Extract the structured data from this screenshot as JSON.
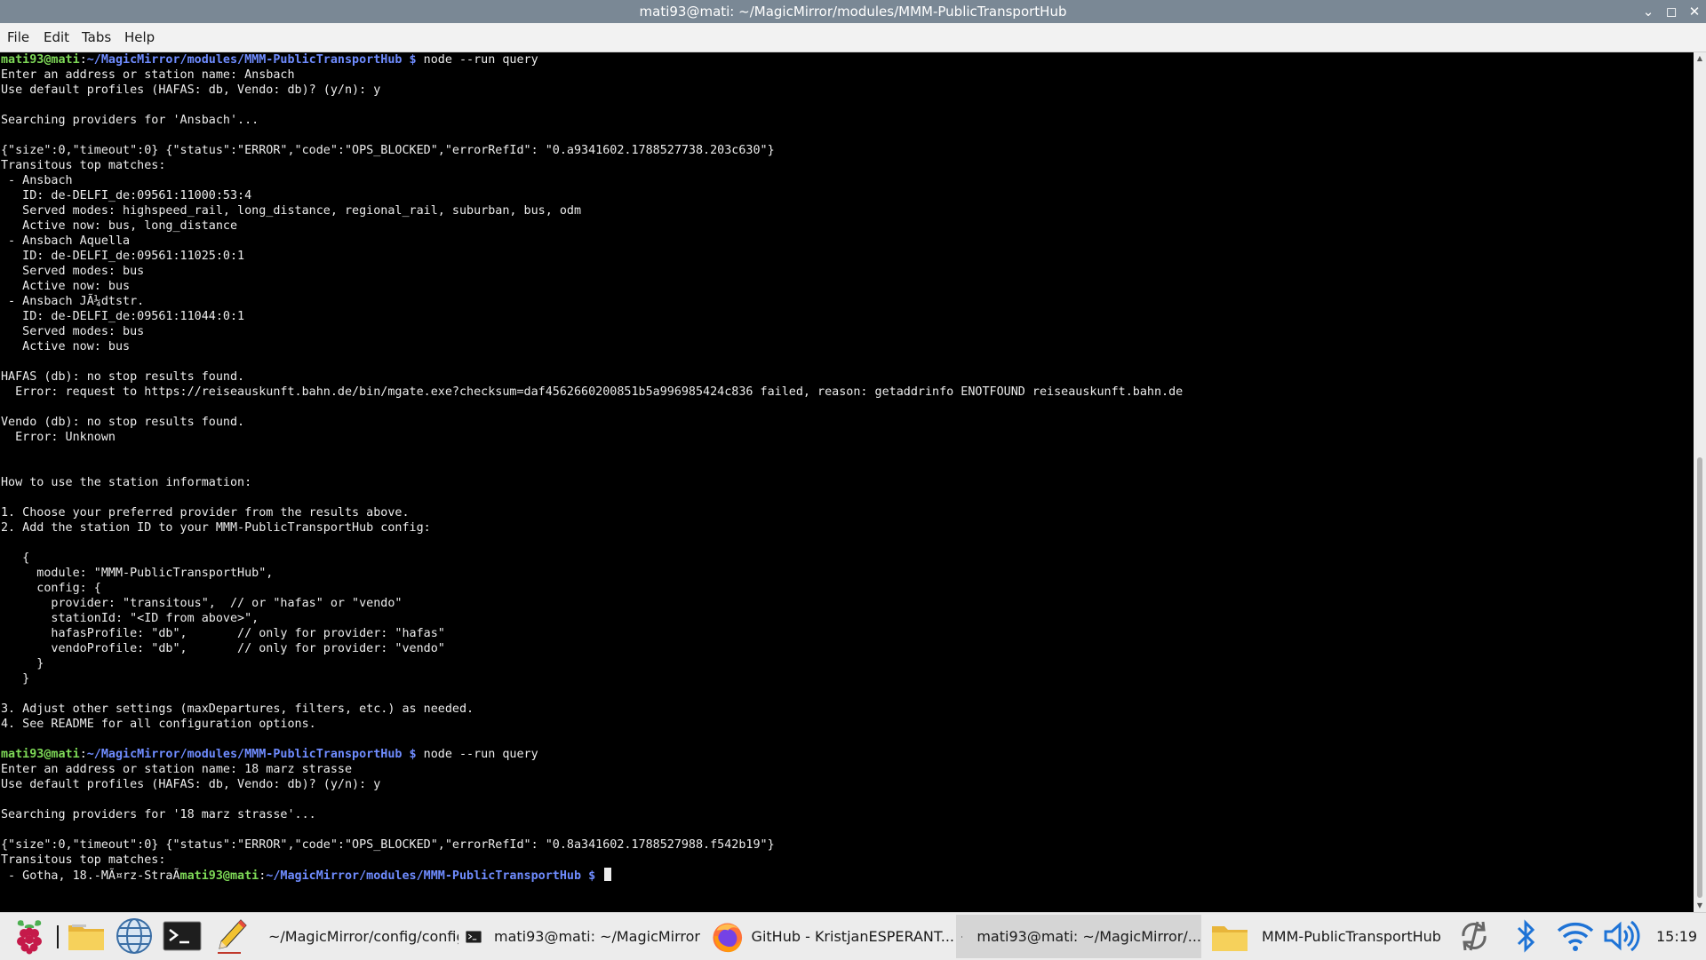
{
  "window": {
    "title": "mati93@mati: ~/MagicMirror/modules/MMM-PublicTransportHub"
  },
  "menu": [
    "File",
    "Edit",
    "Tabs",
    "Help"
  ],
  "terminal": {
    "prompt": {
      "user": "mati93@mati",
      "path": "~/MagicMirror/modules/MMM-PublicTransportHub",
      "symbol": "$"
    },
    "lines": [
      {
        "t": "prompt",
        "cmd": " node --run query"
      },
      {
        "t": "text",
        "text": "Enter an address or station name: Ansbach"
      },
      {
        "t": "text",
        "text": "Use default profiles (HAFAS: db, Vendo: db)? (y/n): y"
      },
      {
        "t": "blank"
      },
      {
        "t": "text",
        "text": "Searching providers for 'Ansbach'..."
      },
      {
        "t": "blank"
      },
      {
        "t": "text",
        "text": "{\"size\":0,\"timeout\":0} {\"status\":\"ERROR\",\"code\":\"OPS_BLOCKED\",\"errorRefId\": \"0.a9341602.1788527738.203c630\"}"
      },
      {
        "t": "text",
        "text": "Transitous top matches:"
      },
      {
        "t": "text",
        "text": " - Ansbach"
      },
      {
        "t": "text",
        "text": "   ID: de-DELFI_de:09561:11000:53:4"
      },
      {
        "t": "text",
        "text": "   Served modes: highspeed_rail, long_distance, regional_rail, suburban, bus, odm"
      },
      {
        "t": "text",
        "text": "   Active now: bus, long_distance"
      },
      {
        "t": "text",
        "text": " - Ansbach Aquella"
      },
      {
        "t": "text",
        "text": "   ID: de-DELFI_de:09561:11025:0:1"
      },
      {
        "t": "text",
        "text": "   Served modes: bus"
      },
      {
        "t": "text",
        "text": "   Active now: bus"
      },
      {
        "t": "text",
        "text": " - Ansbach JÃ¼dtstr."
      },
      {
        "t": "text",
        "text": "   ID: de-DELFI_de:09561:11044:0:1"
      },
      {
        "t": "text",
        "text": "   Served modes: bus"
      },
      {
        "t": "text",
        "text": "   Active now: bus"
      },
      {
        "t": "blank"
      },
      {
        "t": "text",
        "text": "HAFAS (db): no stop results found."
      },
      {
        "t": "text",
        "text": "  Error: request to https://reiseauskunft.bahn.de/bin/mgate.exe?checksum=daf4562660200851b5a996985424c836 failed, reason: getaddrinfo ENOTFOUND reiseauskunft.bahn.de"
      },
      {
        "t": "blank"
      },
      {
        "t": "text",
        "text": "Vendo (db): no stop results found."
      },
      {
        "t": "text",
        "text": "  Error: Unknown"
      },
      {
        "t": "blank"
      },
      {
        "t": "blank"
      },
      {
        "t": "text",
        "text": "How to use the station information:"
      },
      {
        "t": "blank"
      },
      {
        "t": "text",
        "text": "1. Choose your preferred provider from the results above."
      },
      {
        "t": "text",
        "text": "2. Add the station ID to your MMM-PublicTransportHub config:"
      },
      {
        "t": "blank"
      },
      {
        "t": "text",
        "text": "   {"
      },
      {
        "t": "text",
        "text": "     module: \"MMM-PublicTransportHub\","
      },
      {
        "t": "text",
        "text": "     config: {"
      },
      {
        "t": "text",
        "text": "       provider: \"transitous\",  // or \"hafas\" or \"vendo\""
      },
      {
        "t": "text",
        "text": "       stationId: \"<ID from above>\","
      },
      {
        "t": "text",
        "text": "       hafasProfile: \"db\",       // only for provider: \"hafas\""
      },
      {
        "t": "text",
        "text": "       vendoProfile: \"db\",       // only for provider: \"vendo\""
      },
      {
        "t": "text",
        "text": "     }"
      },
      {
        "t": "text",
        "text": "   }"
      },
      {
        "t": "blank"
      },
      {
        "t": "text",
        "text": "3. Adjust other settings (maxDepartures, filters, etc.) as needed."
      },
      {
        "t": "text",
        "text": "4. See README for all configuration options."
      },
      {
        "t": "blank"
      },
      {
        "t": "prompt",
        "cmd": " node --run query"
      },
      {
        "t": "text",
        "text": "Enter an address or station name: 18 marz strasse"
      },
      {
        "t": "text",
        "text": "Use default profiles (HAFAS: db, Vendo: db)? (y/n): y"
      },
      {
        "t": "blank"
      },
      {
        "t": "text",
        "text": "Searching providers for '18 marz strasse'..."
      },
      {
        "t": "blank"
      },
      {
        "t": "text",
        "text": "{\"size\":0,\"timeout\":0} {\"status\":\"ERROR\",\"code\":\"OPS_BLOCKED\",\"errorRefId\": \"0.8a341602.1788527988.f542b19\"}"
      },
      {
        "t": "text",
        "text": "Transitous top matches:"
      },
      {
        "t": "mixed",
        "text": " - Gotha, 18.-MÃ¤rz-StraÃ",
        "cmd": " "
      }
    ]
  },
  "taskbar": {
    "icons": [
      "raspberry-menu-icon",
      "file-manager-icon",
      "web-browser-icon",
      "terminal-icon",
      "text-editor-icon"
    ],
    "windows": [
      {
        "name": "taskbar-editor-window",
        "icon": "text-editor-icon",
        "label": "~/MagicMirror/config/config.js..."
      },
      {
        "name": "taskbar-terminal-window-1",
        "icon": "terminal-icon",
        "label": "mati93@mati: ~/MagicMirror"
      },
      {
        "name": "taskbar-firefox-window",
        "icon": "firefox-icon",
        "label": "GitHub - KristjanESPERANT..."
      },
      {
        "name": "taskbar-terminal-window-2",
        "icon": "terminal-icon",
        "label": "mati93@mati: ~/MagicMirror/...",
        "active": true
      },
      {
        "name": "taskbar-folder-window",
        "icon": "folder-icon",
        "label": "MMM-PublicTransportHub"
      }
    ],
    "tray": [
      "sync-icon",
      "bluetooth-icon",
      "wifi-icon",
      "volume-icon"
    ],
    "clock": "15:19"
  }
}
